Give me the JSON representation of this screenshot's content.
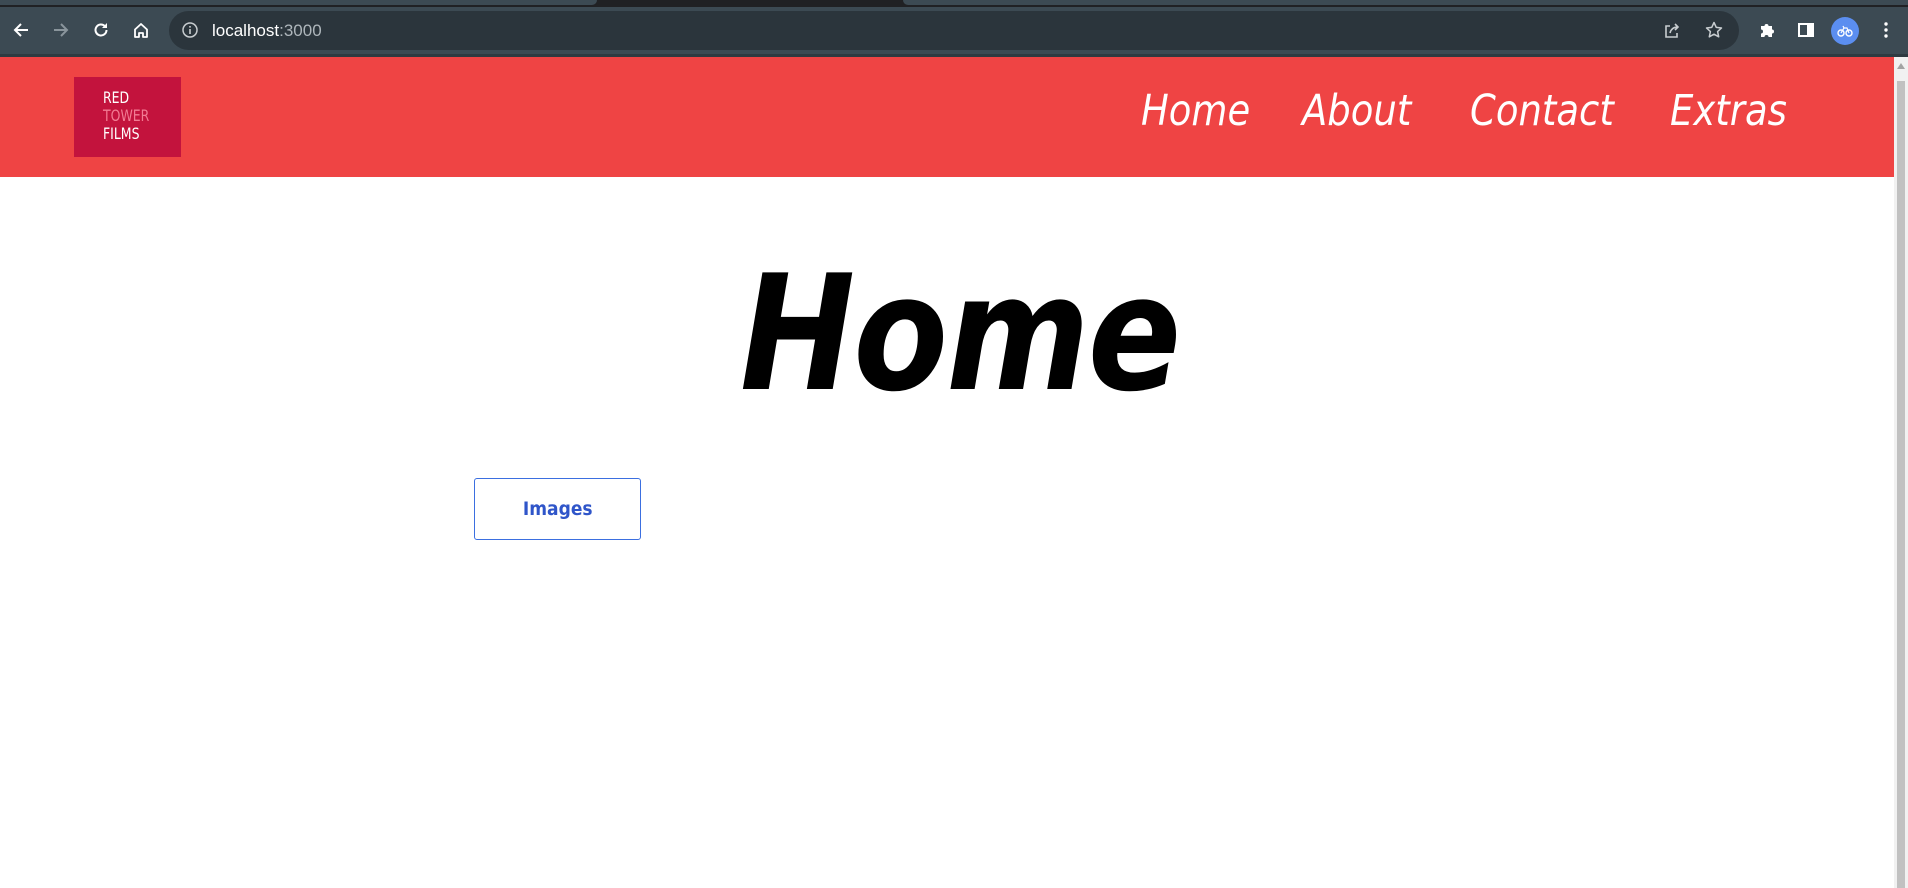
{
  "browser": {
    "url_host": "localhost",
    "url_port": ":3000",
    "icons": [
      "back-icon",
      "forward-icon",
      "reload-icon",
      "home-icon",
      "site-info-icon",
      "share-icon",
      "bookmark-star-icon",
      "extensions-icon",
      "side-panel-icon",
      "profile-avatar",
      "menu-icon"
    ],
    "colors": {
      "toolbar": "#3c4a53",
      "omnibox": "#2b353c"
    }
  },
  "site": {
    "logo": {
      "line1": "RED",
      "line2": "TOWER",
      "line3": "FILMS"
    },
    "nav": [
      {
        "label": "Home"
      },
      {
        "label": "About"
      },
      {
        "label": "Contact"
      },
      {
        "label": "Extras"
      }
    ],
    "colors": {
      "header": "#ef4444",
      "logo_bg": "#c3133d",
      "button_border": "#3b6fe0"
    }
  },
  "main": {
    "title": "Home",
    "images_button": "Images"
  }
}
